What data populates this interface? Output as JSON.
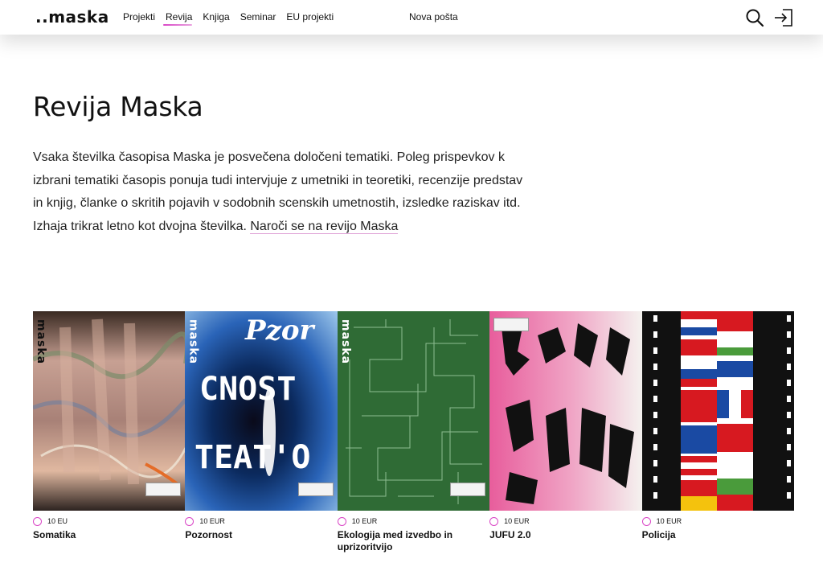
{
  "header": {
    "logo": "..maska",
    "nav": [
      "Projekti",
      "Revija",
      "Knjiga",
      "Seminar",
      "EU projekti"
    ],
    "active_nav": "Revija",
    "post_link": "Nova pošta",
    "icons": [
      "search-icon",
      "login-icon"
    ]
  },
  "main": {
    "title": "Revija Maska",
    "intro": "Vsaka številka časopisa Maska je posvečena določeni tematiki. Poleg prispevkov k izbrani tematiki časopis ponuja tudi intervjuje z umetniki in teoretiki, recenzije predstav in knjig, članke o skritih pojavih v sodobnih scenskih umetnostih, izsledke raziskav itd. Izhaja trikrat letno kot dvojna številka.",
    "subscribe_link": "Naroči se na revijo Maska"
  },
  "issues": [
    {
      "price": "10 EU",
      "title": "Somatika"
    },
    {
      "price": "10 EUR",
      "title": "Pozornost"
    },
    {
      "price": "10 EUR",
      "title": "Ekologija med izvedbo in uprizoritvijo"
    },
    {
      "price": "10 EUR",
      "title": "JUFU 2.0"
    },
    {
      "price": "10 EUR",
      "title": "Policija"
    }
  ],
  "colors": {
    "accent": "#d946c6",
    "text": "#111111"
  }
}
